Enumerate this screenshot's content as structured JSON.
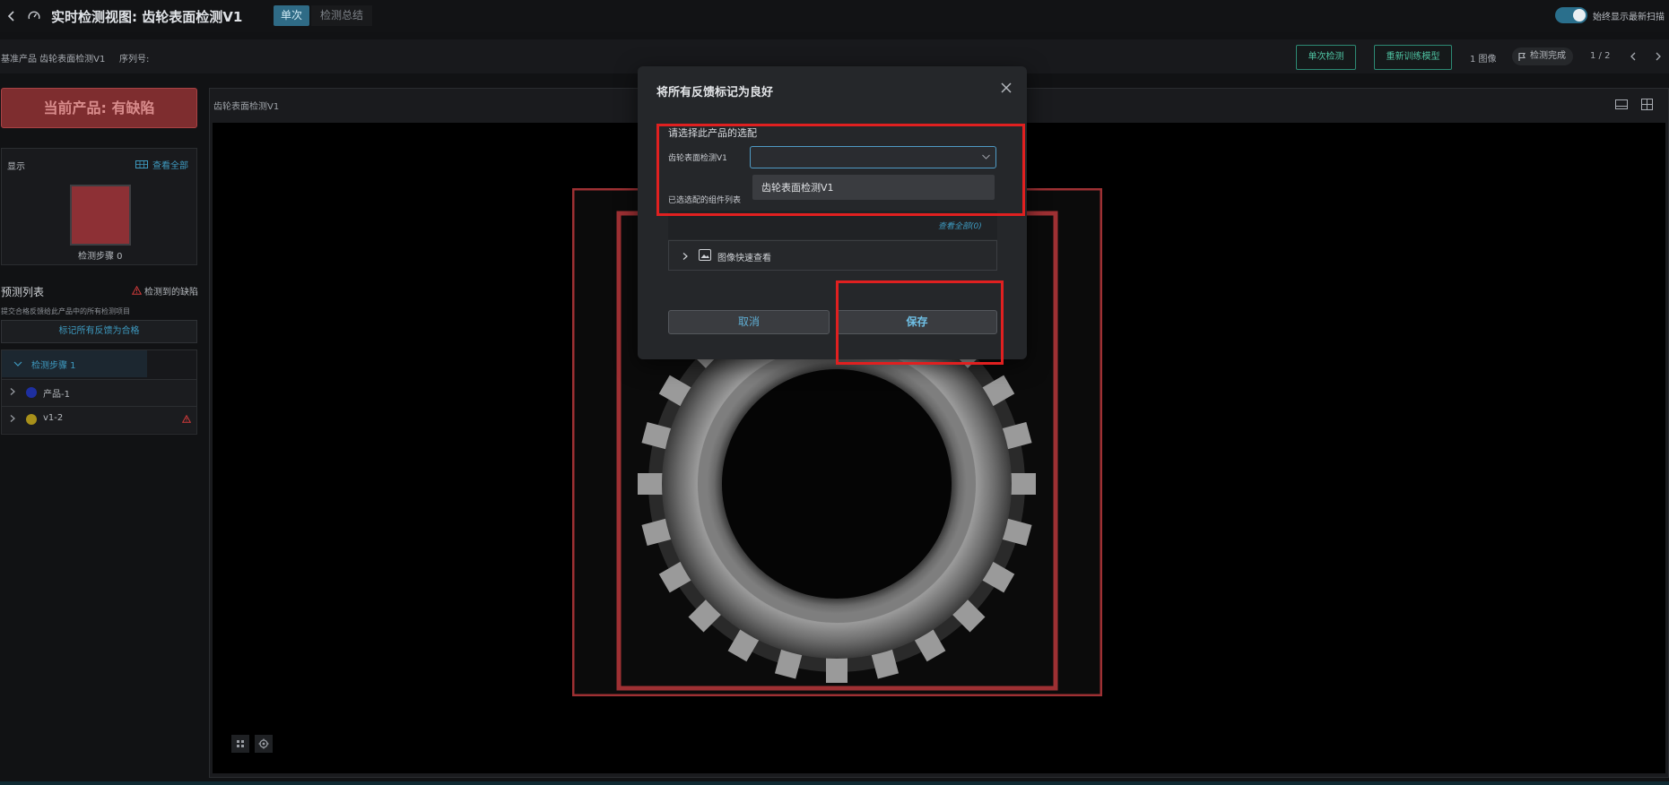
{
  "header": {
    "title": "实时检测视图: 齿轮表面检测V1",
    "tab_single": "单次",
    "tab_summary": "检测总结",
    "toggle_label": "始终显示最新扫描",
    "toggle_on": true
  },
  "subbar": {
    "product": "基准产品 齿轮表面检测V1",
    "serial": "序列号:",
    "single_detect": "单次检测",
    "retrain": "重新训练模型",
    "images": "1 图像",
    "status": "检测完成",
    "page": "1 / 2"
  },
  "sidebar": {
    "current_product": "当前产品: 有缺陷",
    "display_label": "显示",
    "view_all": "查看全部",
    "thumbnail_caption": "检测步骤 0",
    "thumbnail_color": "#8d3035",
    "prediction_title": "预测列表",
    "defects_detected": "检测到的缺陷",
    "prediction_desc": "提交合格反馈给此产品中的所有检测项目",
    "mark_all_button": "标记所有反馈为合格",
    "tree": {
      "step_label": "检测步骤 1",
      "rows": [
        {
          "label": "产品-1",
          "color": "#1e2fa0",
          "warning": false
        },
        {
          "label": "v1-2",
          "color": "#a8901a",
          "warning": true
        }
      ]
    }
  },
  "viewer": {
    "title": "齿轮表面检测V1",
    "box_color": "#9e3033"
  },
  "dialog": {
    "title": "将所有反馈标记为良好",
    "prompt": "请选择此产品的选配",
    "field_label": "齿轮表面检测V1",
    "select_value": "",
    "dropdown_option": "齿轮表面检测V1",
    "selected_list_label": "已选选配的组件列表",
    "view_all": "查看全部(0)",
    "collapse_label": "图像快速查看",
    "cancel": "取消",
    "save": "保存"
  },
  "colors": {
    "accent": "#3e9ac0",
    "defect": "#7e2d2f",
    "highlight": "#e02020",
    "success_outline": "#2d8a74"
  }
}
